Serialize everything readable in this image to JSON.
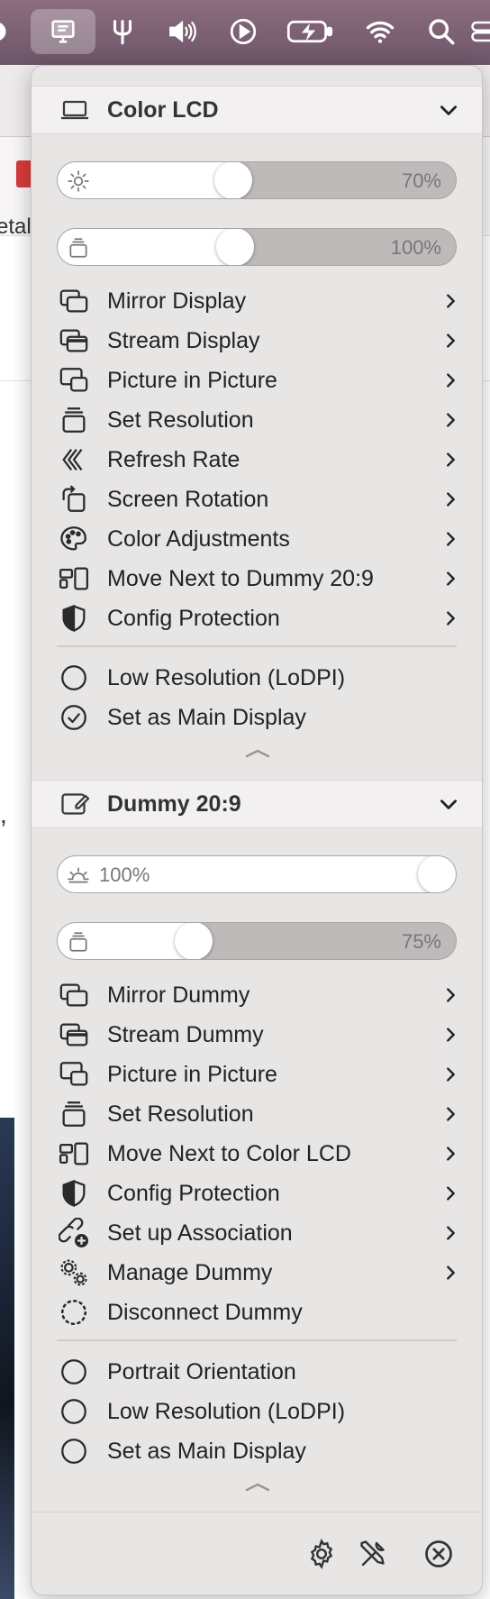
{
  "menubar": {
    "icons": [
      "display-icon",
      "pitchfork-icon",
      "volume-icon",
      "play-icon",
      "battery-charging-icon",
      "wifi-icon",
      "search-icon",
      "control-center-icon"
    ]
  },
  "background": {
    "partial_text": "etal",
    "comma": ","
  },
  "display1": {
    "title": "Color LCD",
    "brightness": {
      "value": 70,
      "label": "70%"
    },
    "contrast": {
      "value": 100,
      "label": "100%"
    },
    "items": [
      {
        "label": "Mirror Display",
        "icon": "mirror-icon",
        "submenu": true
      },
      {
        "label": "Stream Display",
        "icon": "stream-icon",
        "submenu": true
      },
      {
        "label": "Picture in Picture",
        "icon": "pip-icon",
        "submenu": true
      },
      {
        "label": "Set Resolution",
        "icon": "resolution-icon",
        "submenu": true
      },
      {
        "label": "Refresh Rate",
        "icon": "refresh-rate-icon",
        "submenu": true
      },
      {
        "label": "Screen Rotation",
        "icon": "rotation-icon",
        "submenu": true
      },
      {
        "label": "Color Adjustments",
        "icon": "palette-icon",
        "submenu": true
      },
      {
        "label": "Move Next to Dummy 20:9",
        "icon": "arrange-icon",
        "submenu": true
      },
      {
        "label": "Config Protection",
        "icon": "shield-icon",
        "submenu": true
      }
    ],
    "options": [
      {
        "label": "Low Resolution (LoDPI)",
        "checked": false
      },
      {
        "label": "Set as Main Display",
        "checked": true
      }
    ]
  },
  "display2": {
    "title": "Dummy 20:9",
    "brightness": {
      "value": 100,
      "label": "100%"
    },
    "contrast": {
      "value": 75,
      "label": "75%"
    },
    "items": [
      {
        "label": "Mirror Dummy",
        "icon": "mirror-icon",
        "submenu": true
      },
      {
        "label": "Stream Dummy",
        "icon": "stream-icon",
        "submenu": true
      },
      {
        "label": "Picture in Picture",
        "icon": "pip-icon",
        "submenu": true
      },
      {
        "label": "Set Resolution",
        "icon": "resolution-icon",
        "submenu": true
      },
      {
        "label": "Move Next to Color LCD",
        "icon": "arrange-icon",
        "submenu": true
      },
      {
        "label": "Config Protection",
        "icon": "shield-icon",
        "submenu": true
      },
      {
        "label": "Set up Association",
        "icon": "association-icon",
        "submenu": true
      },
      {
        "label": "Manage Dummy",
        "icon": "gears-icon",
        "submenu": true
      },
      {
        "label": "Disconnect Dummy",
        "icon": "disconnect-icon",
        "submenu": false
      }
    ],
    "options": [
      {
        "label": "Portrait Orientation",
        "checked": false
      },
      {
        "label": "Low Resolution (LoDPI)",
        "checked": false
      },
      {
        "label": "Set as Main Display",
        "checked": false
      }
    ]
  },
  "footer": {
    "icons": [
      "settings-gear-icon",
      "tools-icon",
      "quit-icon"
    ]
  }
}
